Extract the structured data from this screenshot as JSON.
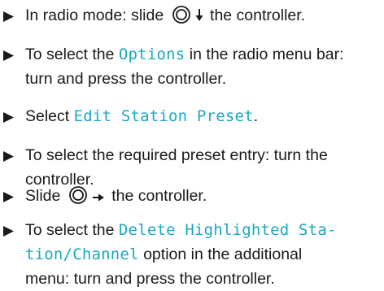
{
  "steps": [
    {
      "before": "In radio mode: slide ",
      "after": " the controller.",
      "controller_icon": "controller-dial-icon",
      "direction_icon": "arrow-down-icon"
    },
    {
      "line1_before": "To select the ",
      "line1_highlight": "Options",
      "line1_after": " in the radio menu bar:",
      "line2": "turn and press the controller."
    },
    {
      "before": "Select ",
      "highlight": "Edit Station Preset",
      "after": "."
    },
    {
      "line1": "To select the required preset entry: turn the",
      "line2": "controller."
    },
    {
      "before": "Slide ",
      "after": " the controller.",
      "controller_icon": "controller-dial-icon",
      "direction_icon": "arrow-right-icon"
    },
    {
      "line1_before": "To select the ",
      "line1_highlight": "Delete Highlighted Sta-",
      "line2_highlight": "tion/Channel",
      "line2_after": " option in the additional",
      "line3": "menu: turn and press the controller."
    }
  ],
  "colors": {
    "text": "#1a1a1a",
    "highlight": "#1aa7c4",
    "marker": "#1a1a1a"
  },
  "icons": {
    "bullet": "triangle-bullet-icon"
  }
}
